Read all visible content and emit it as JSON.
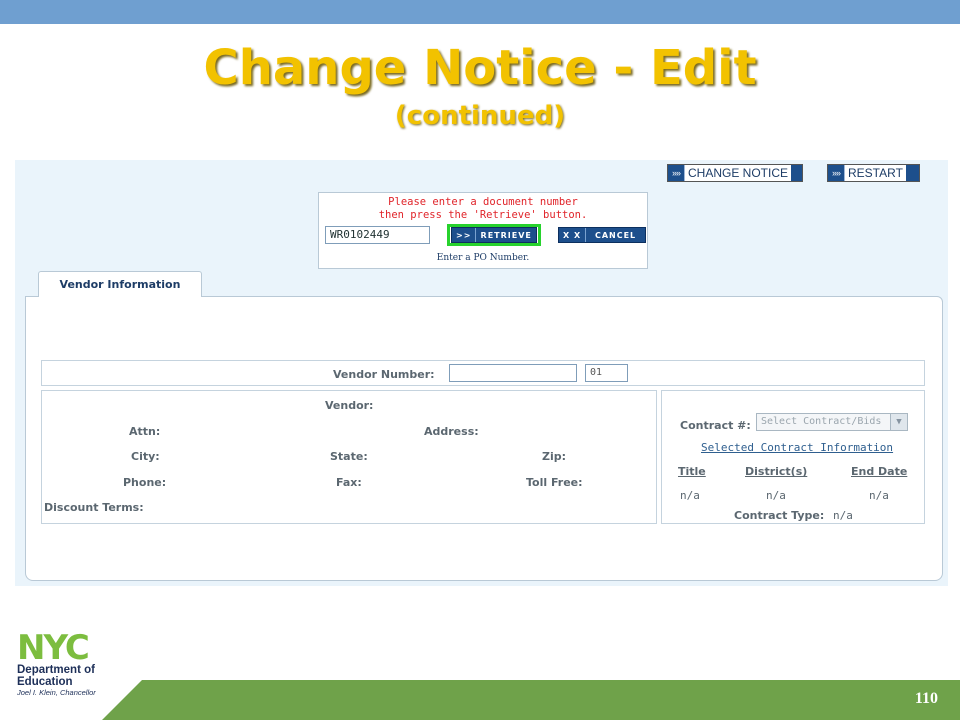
{
  "slide": {
    "title": "Change Notice - Edit",
    "subtitle": "(continued)",
    "page_number": "110",
    "colors": {
      "title": "#f2c200",
      "top_bar": "#6f9fd0",
      "footer": "#6fa24a"
    }
  },
  "toolbar": {
    "change_notice_chevrons": "››››",
    "change_notice_label": "CHANGE NOTICE",
    "restart_chevrons": "››››",
    "restart_label": "RESTART"
  },
  "retrieve": {
    "prompt_line1": "Please enter a document number",
    "prompt_line2": "then press the 'Retrieve' button.",
    "document_number": "WR0102449",
    "retrieve_chevrons": ">>",
    "retrieve_label": "RETRIEVE",
    "cancel_chevrons": "X X",
    "cancel_label": "CANCEL",
    "hint": "Enter a PO Number."
  },
  "tabs": {
    "vendor_information": "Vendor Information"
  },
  "vendor": {
    "vendor_number_label": "Vendor Number:",
    "vendor_number_value": "",
    "vendor_suffix_value": "01",
    "vendor_label": "Vendor:",
    "attn_label": "Attn:",
    "address_label": "Address:",
    "city_label": "City:",
    "state_label": "State:",
    "zip_label": "Zip:",
    "phone_label": "Phone:",
    "fax_label": "Fax:",
    "toll_free_label": "Toll Free:",
    "discount_terms_label": "Discount Terms:"
  },
  "contract": {
    "contract_label": "Contract #:",
    "select_placeholder": "Select Contract/Bids",
    "selected_info_link": "Selected Contract Information",
    "col_title": "Title",
    "col_districts": "District(s)",
    "col_end_date": "End Date",
    "title_value": "n/a",
    "districts_value": "n/a",
    "end_date_value": "n/a",
    "contract_type_label": "Contract Type:",
    "contract_type_value": "n/a"
  },
  "logo": {
    "nyc": "NYC",
    "dept_line1": "Department of",
    "dept_line2": "Education",
    "signature": "Joel I. Klein, Chancellor"
  }
}
